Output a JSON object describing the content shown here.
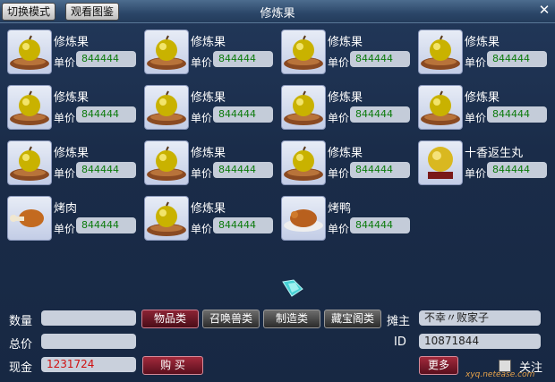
{
  "window": {
    "title": "修炼果"
  },
  "toolbar": {
    "switch_mode_label": "切换模式",
    "view_catalog_label": "观看图鉴",
    "close_symbol": "✕"
  },
  "price_label": "单价",
  "items": [
    {
      "name": "修炼果",
      "price": "844444",
      "icon": "fruit-icon"
    },
    {
      "name": "修炼果",
      "price": "844444",
      "icon": "fruit-icon"
    },
    {
      "name": "修炼果",
      "price": "844444",
      "icon": "fruit-icon"
    },
    {
      "name": "修炼果",
      "price": "844444",
      "icon": "fruit-icon"
    },
    {
      "name": "修炼果",
      "price": "844444",
      "icon": "fruit-icon"
    },
    {
      "name": "修炼果",
      "price": "844444",
      "icon": "fruit-icon"
    },
    {
      "name": "修炼果",
      "price": "844444",
      "icon": "fruit-icon"
    },
    {
      "name": "修炼果",
      "price": "844444",
      "icon": "fruit-icon"
    },
    {
      "name": "修炼果",
      "price": "844444",
      "icon": "fruit-icon"
    },
    {
      "name": "修炼果",
      "price": "844444",
      "icon": "fruit-icon"
    },
    {
      "name": "修炼果",
      "price": "844444",
      "icon": "fruit-icon"
    },
    {
      "name": "十香返生丸",
      "price": "844444",
      "icon": "pill-icon"
    },
    {
      "name": "烤肉",
      "price": "844444",
      "icon": "roast-meat-icon"
    },
    {
      "name": "修炼果",
      "price": "844444",
      "icon": "fruit-icon"
    },
    {
      "name": "烤鸭",
      "price": "844444",
      "icon": "roast-duck-icon"
    }
  ],
  "form": {
    "quantity_label": "数量",
    "quantity_value": "",
    "total_label": "总价",
    "total_value": "",
    "cash_label": "现金",
    "cash_value": "1231724",
    "buy_label": "购 买"
  },
  "categories": [
    "物品类",
    "召唤兽类",
    "制造类",
    "藏宝阁类"
  ],
  "active_category": "物品类",
  "seller": {
    "owner_label": "摊主",
    "owner_value": "不幸〃败家子",
    "id_label": "ID",
    "id_value": "10871844",
    "more_label": "更多",
    "follow_label": "关注"
  },
  "watermark": {
    "site": "xyq.netease.com"
  },
  "colors": {
    "price_text": "#0b7a0b",
    "cash_text": "#d01010",
    "active_button": "#8b2334"
  }
}
